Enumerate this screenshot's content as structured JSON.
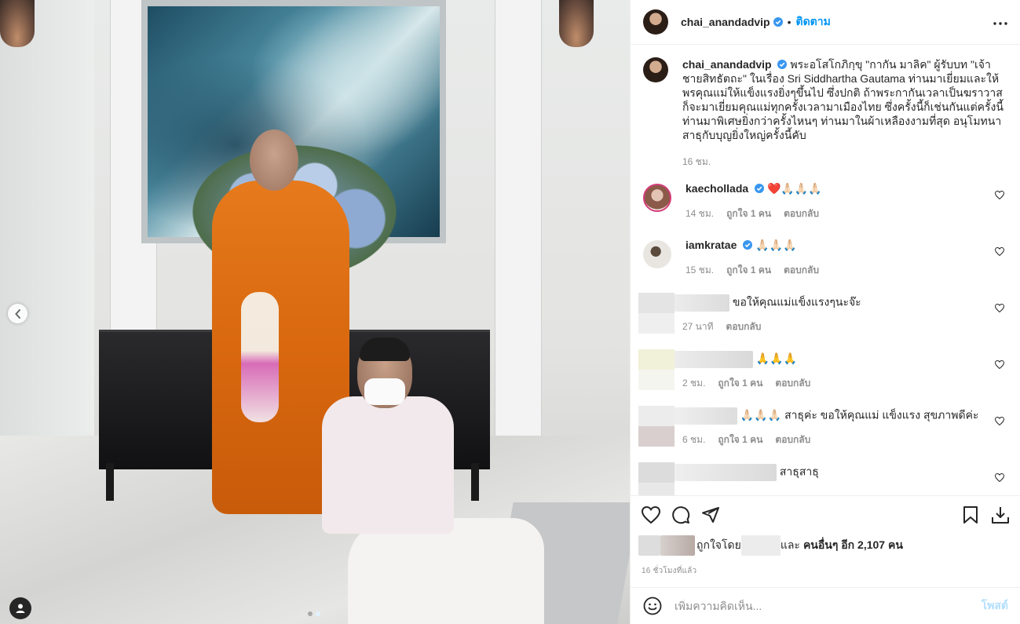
{
  "colors": {
    "accent": "#0095f6",
    "verified": "#3897f0",
    "text": "#262626",
    "muted": "#8e8e8e",
    "post_disabled": "#b2dffc"
  },
  "post": {
    "author": "chai_anandadvip",
    "follow_label": "ติดตาม",
    "separator": "•",
    "caption": "พระอโสโกภิกฺขุ \"กากัน มาลิค\" ผู้รับบท \"เจ้าชายสิทธัตถะ\" ในเรื่อง Sri Siddhartha Gautama ท่านมาเยี่ยมและให้พรคุณแม่ให้แข็งแรงยิ่งๆขึ้นไป ซึ่งปกติ ถ้าพระกากันเวลาเป็นฆราวาสก็จะมาเยี่ยมคุณแม่ทุกครั้งเวลามาเมืองไทย ซึ่งครั้งนี้ก็เช่นกันแต่ครั้งนี้ท่านมาพิเศษยิ่งกว่าครั้งไหนๆ ท่านมาในผ้าเหลืองงามที่สุด อนุโมทนาสาธุกับบุญยิ่งใหญ่ครั้งนี้คับ",
    "caption_time": "16 ชม."
  },
  "comments": [
    {
      "user": "kaechollada",
      "verified": true,
      "text": "❤️️🙏🏻🙏🏻🙏🏻",
      "time": "14 ชม.",
      "likes": "ถูกใจ 1 คน",
      "reply": "ตอบกลับ",
      "avatar_color": "#b07a68"
    },
    {
      "user": "iamkratae",
      "verified": true,
      "text": "🙏🏻🙏🏻🙏🏻",
      "time": "15 ชม.",
      "likes": "ถูกใจ 1 คน",
      "reply": "ตอบกลับ",
      "avatar_color": "#d5cfc8"
    },
    {
      "user": "",
      "verified": false,
      "text": "ขอให้คุณแม่แข็งแรงๆนะจ๊ะ",
      "time": "27 นาที",
      "likes": "",
      "reply": "ตอบกลับ",
      "avatar_color": "#e6e6e6"
    },
    {
      "user": "",
      "verified": false,
      "text": "🙏🙏🙏",
      "time": "2 ชม.",
      "likes": "ถูกใจ 1 คน",
      "reply": "ตอบกลับ",
      "avatar_color": "#f0f0d8"
    },
    {
      "user": "",
      "verified": false,
      "text": "🙏🏻🙏🏻🙏🏻 สาธุค่ะ ขอให้คุณแม่ แข็งแรง สุขภาพดีค่ะ",
      "time": "6 ชม.",
      "likes": "ถูกใจ 1 คน",
      "reply": "ตอบกลับ",
      "avatar_color": "#d9cfcf"
    },
    {
      "user": "",
      "verified": false,
      "text": "สาธุสาธุ",
      "time": "",
      "likes": "",
      "reply": "",
      "avatar_color": "#d8d8d8"
    }
  ],
  "likes_line": {
    "prefix": "ถูกใจโดย",
    "middle": "และ",
    "others": "คนอื่นๆ อีก 2,107 คน"
  },
  "post_time": "16 ชั่วโมงที่แล้ว",
  "add_comment": {
    "placeholder": "เพิ่มความคิดเห็น...",
    "post_label": "โพสต์"
  },
  "icons": [
    "chevron-left-icon",
    "user-tag-icon",
    "more-icon",
    "verified-icon",
    "heart-icon",
    "comment-icon",
    "share-icon",
    "bookmark-icon",
    "download-icon",
    "emoji-icon"
  ]
}
